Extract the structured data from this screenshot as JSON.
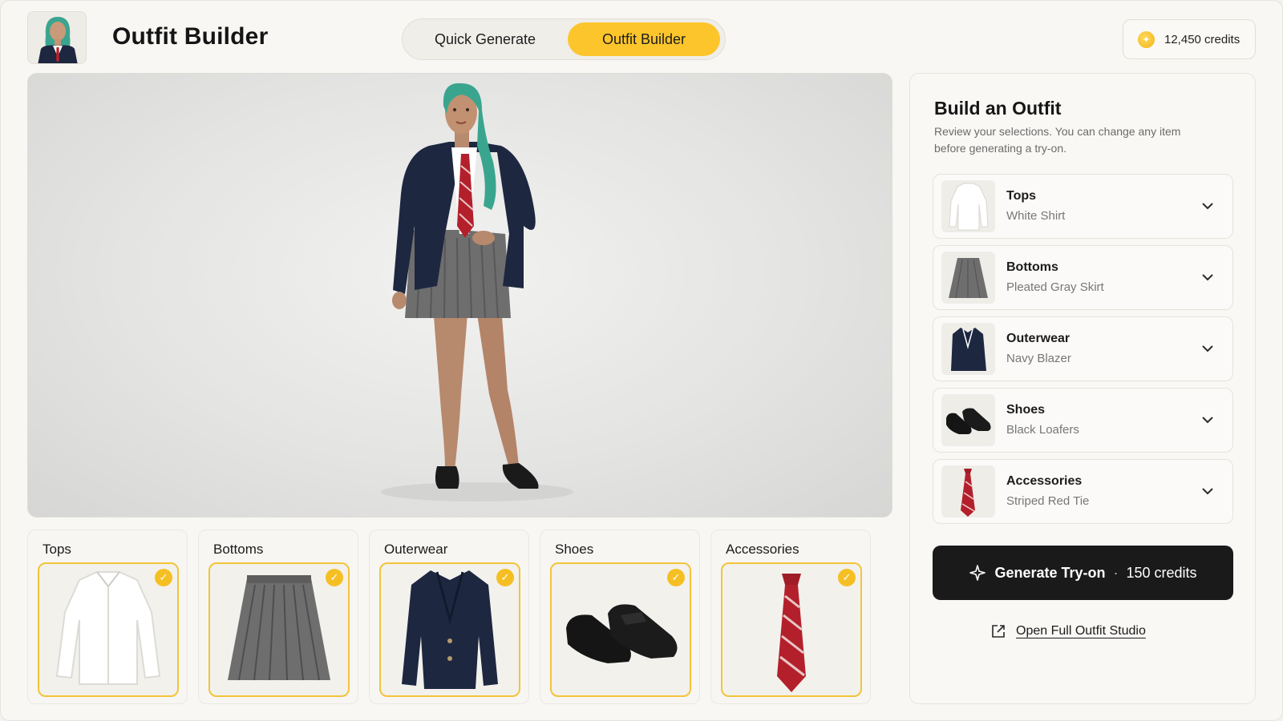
{
  "header": {
    "title": "Outfit Builder",
    "modes": [
      {
        "label": "Quick Generate",
        "active": false
      },
      {
        "label": "Outfit Builder",
        "active": true
      }
    ],
    "credits": "12,450 credits"
  },
  "categories": [
    {
      "label": "Tops",
      "selected": true
    },
    {
      "label": "Bottoms",
      "selected": true
    },
    {
      "label": "Outerwear",
      "selected": true
    },
    {
      "label": "Shoes",
      "selected": true
    },
    {
      "label": "Accessories",
      "selected": true
    }
  ],
  "panel": {
    "title": "Build an Outfit",
    "description": "Review your selections. You can change any item before generating a try-on.",
    "selections": [
      {
        "category": "Tops",
        "item": "White Shirt"
      },
      {
        "category": "Bottoms",
        "item": "Pleated Gray Skirt"
      },
      {
        "category": "Outerwear",
        "item": "Navy Blazer"
      },
      {
        "category": "Shoes",
        "item": "Black Loafers"
      },
      {
        "category": "Accessories",
        "item": "Striped Red Tie"
      }
    ],
    "generate": {
      "label": "Generate Try-on",
      "separator": "·",
      "cost": "150 credits"
    },
    "studio_link": "Open Full Outfit Studio"
  },
  "colors": {
    "accent": "#fcc52c",
    "dark_button": "#1a1a1a",
    "navy": "#1d2740",
    "skirt_gray": "#6e6e6e",
    "tie_red": "#b3202c",
    "hair_teal": "#3aa58f"
  },
  "icons": {
    "coin": "coin-icon",
    "check": "check-icon",
    "chevron": "chevron-down-icon",
    "sparkle": "sparkle-icon",
    "external": "external-link-icon"
  }
}
